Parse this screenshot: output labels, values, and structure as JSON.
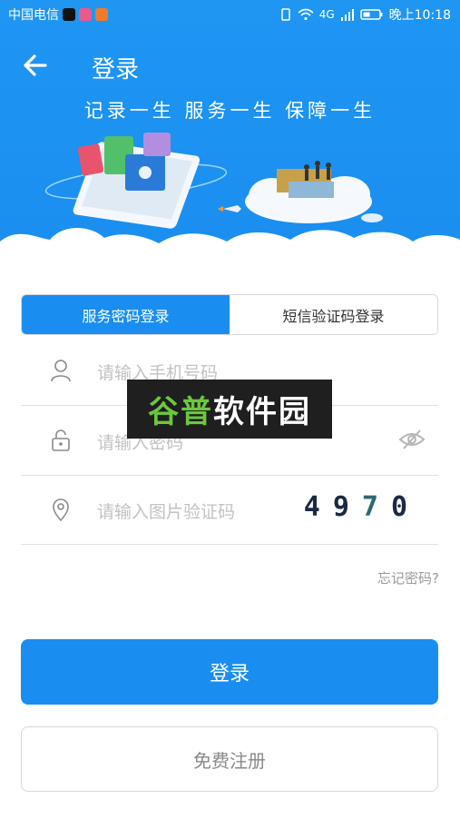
{
  "status_bar": {
    "carrier": "中国电信",
    "network": "4G",
    "time": "晚上10:18"
  },
  "header": {
    "title": "登录",
    "slogan": "记录一生 服务一生 保障一生"
  },
  "tabs": [
    {
      "label": "服务密码登录",
      "active": true
    },
    {
      "label": "短信验证码登录",
      "active": false
    }
  ],
  "fields": {
    "phone_placeholder": "请输入手机号码",
    "password_placeholder": "请输入密码",
    "captcha_placeholder": "请输入图片验证码",
    "captcha_code": [
      "4",
      "9",
      "7",
      "0"
    ]
  },
  "forgot_password": "忘记密码?",
  "login_button": "登录",
  "register_button": "免费注册",
  "watermark": {
    "part1": "谷普",
    "part2": "软件园"
  },
  "colors": {
    "primary": "#1a8ef0",
    "placeholder": "#c2c2c2",
    "border": "#d8d8d8"
  },
  "icons": {
    "back": "arrow-left-icon",
    "phone": "user-icon",
    "password": "lock-icon",
    "captcha": "location-pin-icon",
    "toggle_password": "eye-off-icon"
  }
}
